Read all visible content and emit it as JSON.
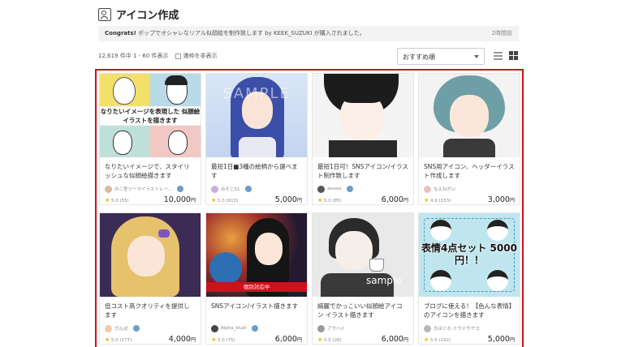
{
  "header": {
    "title": "アイコン作成",
    "icon": "user-portrait-icon"
  },
  "notice": {
    "lead": "Congrats!",
    "message": "ポップでオシャレなリアル似顔絵を制作致します by KEEK_SUZUKI が購入されました。",
    "time": "2時間前"
  },
  "results": {
    "count_text": "12,619 件中 1 - 60 件表示",
    "checkbox_label": "満枠を非表示"
  },
  "sort": {
    "selected": "おすすめ順"
  },
  "colors": {
    "frame": "#d0101a",
    "star": "#f0b400"
  },
  "cards": [
    {
      "title": "なりたいイメージで、スタイリッシュな似顔絵描きます",
      "seller": "のこ型ツーマイラストレー…",
      "rating": "5.0",
      "reviews": "(55)",
      "price": "10,000",
      "yen": "円",
      "overlay": "なりたいイメージを表現した 似顔絵イラストを描きます"
    },
    {
      "title": "最短1日■3種の絵柄から選べます",
      "seller": "みそじ51",
      "rating": "5.0",
      "reviews": "(613)",
      "price": "5,000",
      "yen": "円",
      "overlay": "SAMPLE"
    },
    {
      "title": "最短1日可！SNSアイコン/イラスト制作致します",
      "seller": "asuwa",
      "rating": "5.0",
      "reviews": "(85)",
      "price": "6,000",
      "yen": "円",
      "overlay": ""
    },
    {
      "title": "SNS用アイコン、ヘッダーイラスト作成します",
      "seller": "なえねがい",
      "rating": "4.9",
      "reviews": "(153)",
      "price": "3,000",
      "yen": "円",
      "overlay": ""
    },
    {
      "title": "低コスト高クオリティを提供します",
      "seller": "ぴんぽ",
      "rating": "5.0",
      "reviews": "(177)",
      "price": "4,000",
      "yen": "円",
      "overlay": ""
    },
    {
      "title": "SNSアイコン/イラスト描きます",
      "seller": "Alpha_Illust",
      "rating": "5.0",
      "reviews": "(75)",
      "price": "6,000",
      "yen": "円",
      "overlay": "個別対応中"
    },
    {
      "title": "綺麗でかっこいい似顔絵アイコン イラスト描きます",
      "seller": "アサハナ",
      "rating": "5.0",
      "reviews": "(26)",
      "price": "6,000",
      "yen": "円",
      "overlay": "sample"
    },
    {
      "title": "ブログに使える！【色んな表情】のアイコンを描きます",
      "seller": "大ほとわ ミウナサヤコ",
      "rating": "5.0",
      "reviews": "(192)",
      "price": "5,000",
      "yen": "円",
      "overlay": "表情4点セット 5000円！！"
    }
  ]
}
